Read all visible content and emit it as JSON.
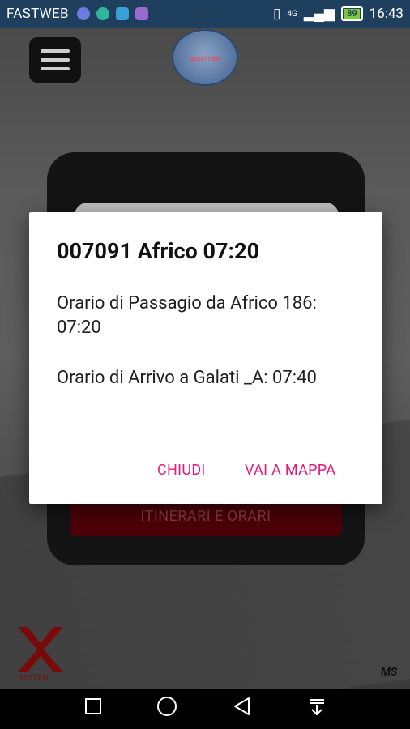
{
  "status_bar": {
    "carrier": "FASTWEB",
    "time": "16:43",
    "battery": "89",
    "network": "4G"
  },
  "app": {
    "logo_text": "autolinee",
    "itinerari_button": "ITINERARI E ORARI",
    "brand_left": "SYSTEM",
    "brand_right": "MS"
  },
  "dialog": {
    "title": "007091 Africo 07:20",
    "message_1": "Orario di Passagio da  Africo 186: 07:20",
    "message_2": "Orario di Arrivo a Galati _A: 07:40",
    "close_button": "CHIUDI",
    "map_button": "VAI A MAPPA"
  },
  "nav": {
    "recent_icon": "square-icon",
    "home_icon": "circle-icon",
    "back_icon": "triangle-icon",
    "notifications_icon": "download-icon"
  },
  "colors": {
    "accent": "#e8177a",
    "status_bar": "#1f3f5f",
    "button_bg": "#4b0007"
  }
}
